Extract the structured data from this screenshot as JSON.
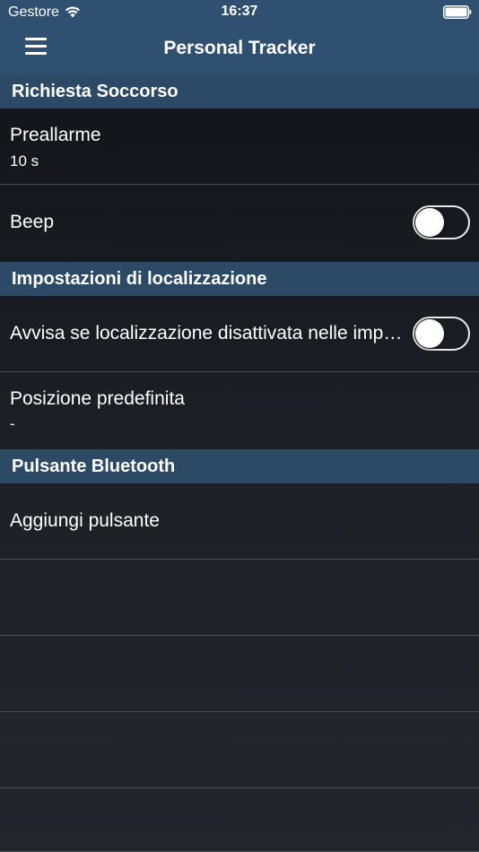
{
  "status_bar": {
    "carrier": "Gestore",
    "time": "16:37",
    "wifi_icon": "wifi-icon",
    "battery_icon": "battery-icon"
  },
  "nav": {
    "menu_icon": "hamburger-menu-icon",
    "title": "Personal Tracker"
  },
  "sections": {
    "soccorso": {
      "header": "Richiesta Soccorso",
      "preallarme": {
        "title": "Preallarme",
        "value": "10 s"
      },
      "beep": {
        "title": "Beep",
        "toggle_on": false
      }
    },
    "localizzazione": {
      "header": "Impostazioni di localizzazione",
      "avvisa": {
        "title": "Avvisa se localizzazione disattivata nelle impostazioni",
        "toggle_on": false
      },
      "posizione": {
        "title": "Posizione predefinita",
        "value": "-"
      }
    },
    "bluetooth": {
      "header": "Pulsante Bluetooth",
      "aggiungi": {
        "title": "Aggiungi pulsante"
      }
    }
  },
  "colors": {
    "header_bg": "#2f5070",
    "section_bg": "#2c4a66",
    "separator": "#4a4e55"
  }
}
